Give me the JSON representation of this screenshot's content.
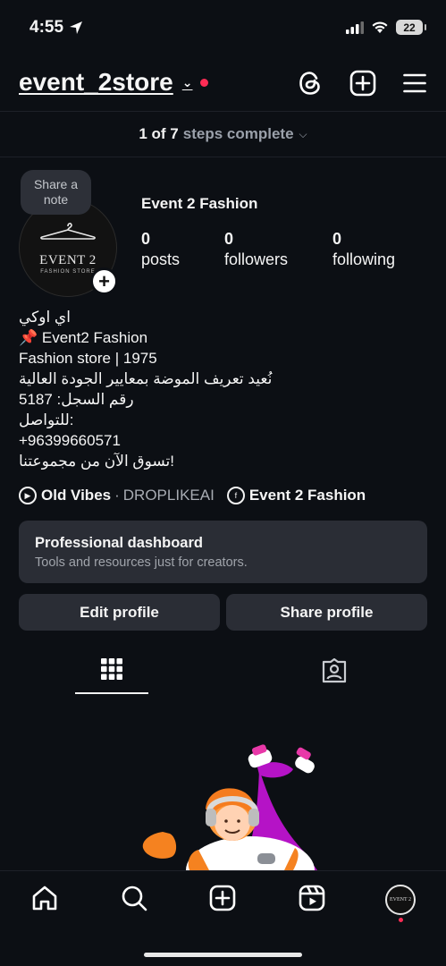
{
  "status": {
    "time": "4:55",
    "battery": "22"
  },
  "header": {
    "username": "event_2store"
  },
  "steps": {
    "count": "1 of 7",
    "label": "steps complete"
  },
  "profile": {
    "note": "Share a note",
    "avatar_logo": "EVENT 2",
    "avatar_sub": "FASHION STORE",
    "display_name": "Event 2 Fashion",
    "stats": [
      {
        "value": "0",
        "label": "posts"
      },
      {
        "value": "0",
        "label": "followers"
      },
      {
        "value": "0",
        "label": "following"
      }
    ]
  },
  "bio": [
    "اي اوكي",
    "📌 Event2 Fashion",
    "Fashion store | 1975",
    "نُعيد تعريف الموضة بمعايير الجودة العالية",
    "رقم السجل: 5187",
    "للتواصل:",
    "+96399660571",
    "تسوق الآن من مجموعتنا!"
  ],
  "links": {
    "music_title": "Old Vibes",
    "music_artist": "DROPLIKEAI",
    "facebook": "Event 2 Fashion"
  },
  "pro_dashboard": {
    "title": "Professional dashboard",
    "subtitle": "Tools and resources just for creators."
  },
  "buttons": {
    "edit": "Edit profile",
    "share": "Share profile"
  },
  "colors": {
    "background": "#0c0f14",
    "card": "#2a2d35",
    "accent_red": "#ff2c55"
  }
}
